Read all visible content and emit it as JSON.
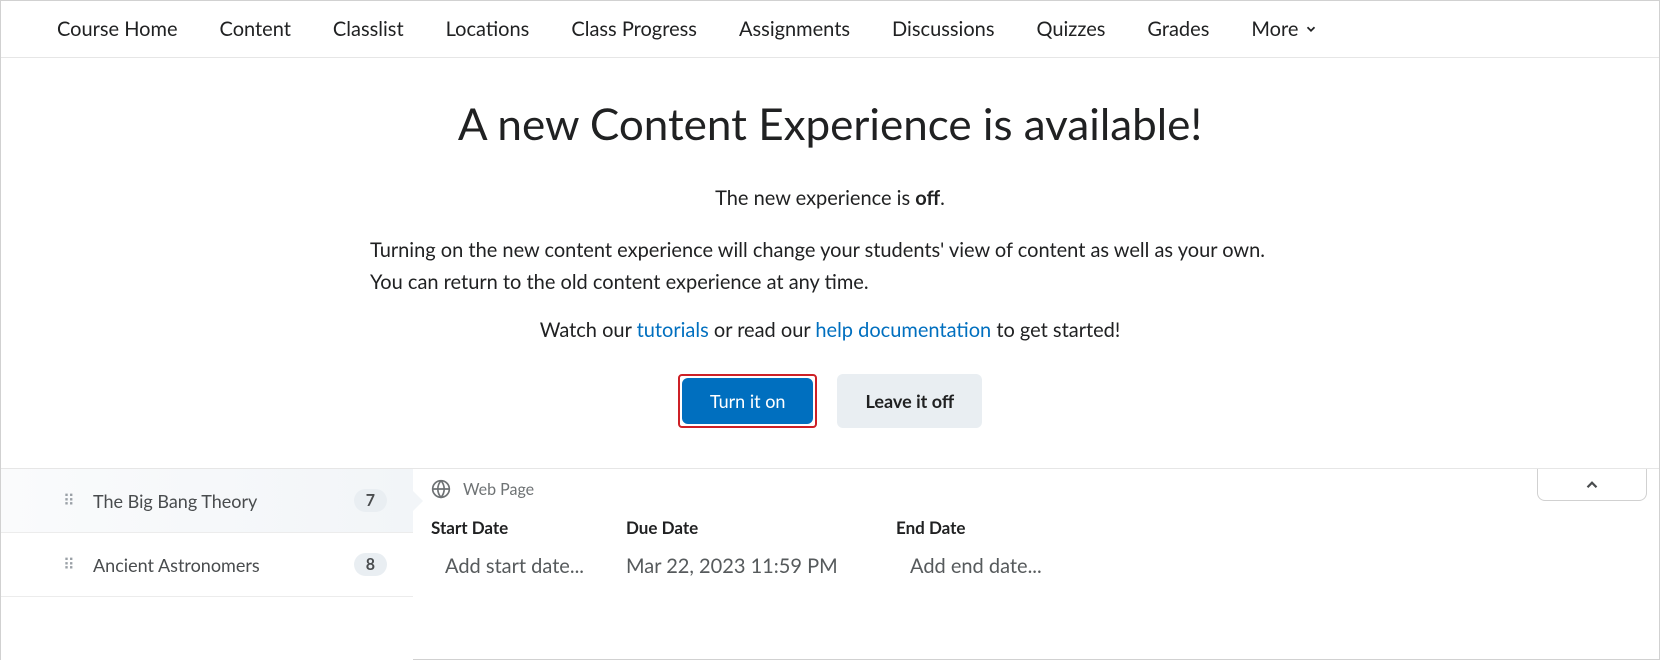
{
  "nav": {
    "items": [
      "Course Home",
      "Content",
      "Classlist",
      "Locations",
      "Class Progress",
      "Assignments",
      "Discussions",
      "Quizzes",
      "Grades"
    ],
    "more": "More"
  },
  "banner": {
    "title": "A new Content Experience is available!",
    "status_prefix": "The new experience is ",
    "status_value": "off",
    "status_suffix": ".",
    "body": "Turning on the new content experience will change your students' view of content as well as your own. You can return to the old content experience at any time.",
    "links_prefix": "Watch our ",
    "tutorials_link": "tutorials",
    "links_mid": " or read our ",
    "help_link": "help documentation",
    "links_suffix": " to get started!",
    "turn_on": "Turn it on",
    "leave_off": "Leave it off"
  },
  "sidebar": {
    "items": [
      {
        "label": "The Big Bang Theory",
        "count": "7",
        "active": true
      },
      {
        "label": "Ancient Astronomers",
        "count": "8",
        "active": false
      }
    ]
  },
  "topic": {
    "type_label": "Web Page",
    "headers": {
      "start": "Start Date",
      "due": "Due Date",
      "end": "End Date"
    },
    "values": {
      "start": "Add start date...",
      "due": "Mar 22, 2023 11:59 PM",
      "end": "Add end date..."
    }
  }
}
